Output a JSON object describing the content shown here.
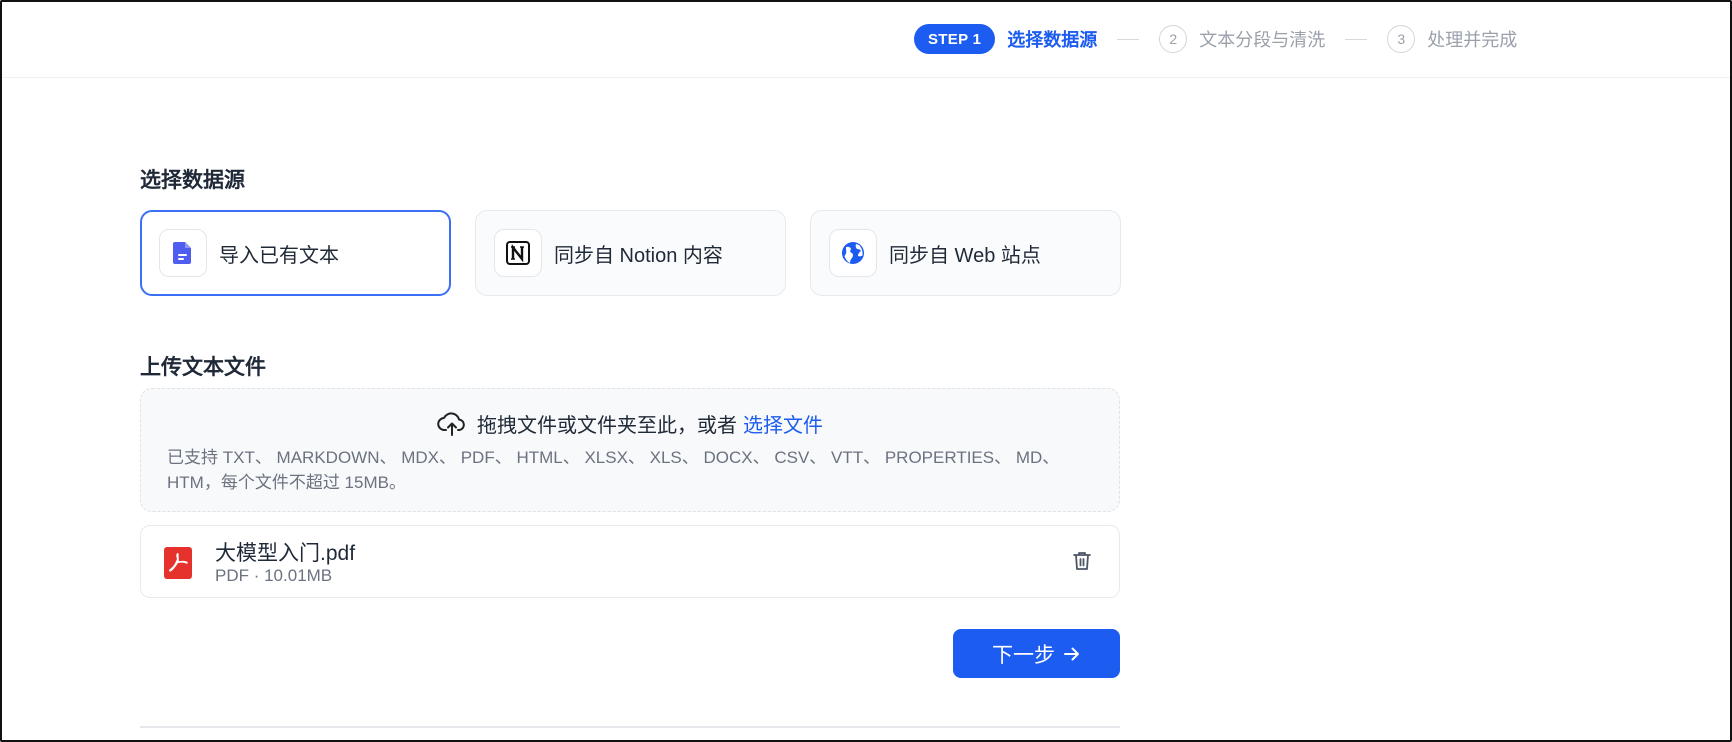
{
  "stepper": {
    "step1_badge": "STEP 1",
    "step1_label": "选择数据源",
    "step2_number": "2",
    "step2_label": "文本分段与清洗",
    "step3_number": "3",
    "step3_label": "处理并完成"
  },
  "data_source": {
    "title": "选择数据源",
    "options": [
      {
        "label": "导入已有文本",
        "icon": "document-icon",
        "selected": true
      },
      {
        "label": "同步自 Notion 内容",
        "icon": "notion-icon",
        "selected": false
      },
      {
        "label": "同步自 Web 站点",
        "icon": "web-globe-icon",
        "selected": false
      }
    ]
  },
  "upload": {
    "title": "上传文本文件",
    "drop_text": "拖拽文件或文件夹至此，或者",
    "select_link": "选择文件",
    "support_text": "已支持 TXT、 MARKDOWN、 MDX、 PDF、 HTML、 XLSX、 XLS、 DOCX、 CSV、 VTT、 PROPERTIES、 MD、 HTM，每个文件不超过 15MB。"
  },
  "files": [
    {
      "name": "大模型入门.pdf",
      "meta": "PDF · 10.01MB",
      "icon": "pdf-file-icon"
    }
  ],
  "actions": {
    "next_label": "下一步"
  },
  "colors": {
    "primary": "#1d5cf0",
    "pdf_red": "#e5322d"
  }
}
